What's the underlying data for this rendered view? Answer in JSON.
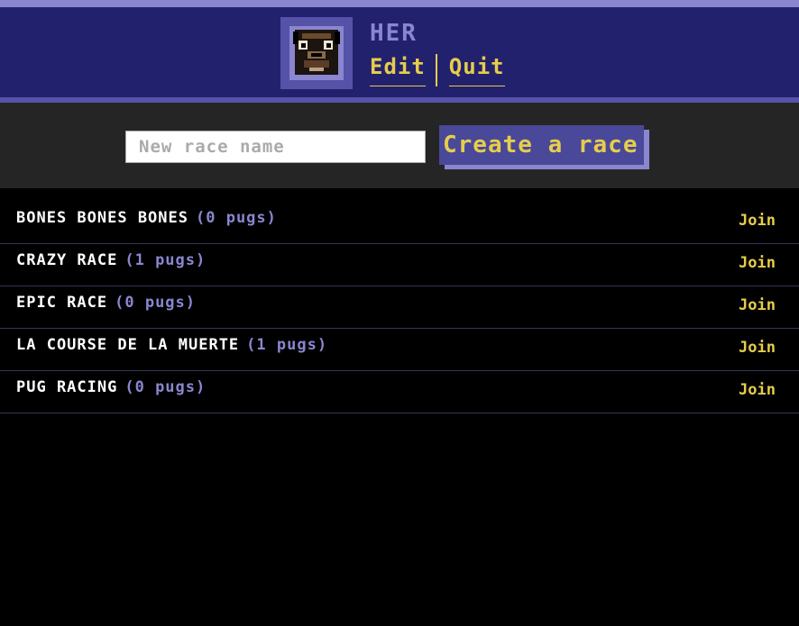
{
  "header": {
    "username": "HER",
    "edit_label": "Edit",
    "quit_label": "Quit",
    "avatar_icon": "pug-avatar-icon"
  },
  "create": {
    "placeholder": "New race name",
    "button_label": "Create a race"
  },
  "races": [
    {
      "name": "BONES BONES BONES",
      "count": "(0 pugs)",
      "join_label": "Join"
    },
    {
      "name": "CRAZY RACE",
      "count": "(1 pugs)",
      "join_label": "Join"
    },
    {
      "name": "EPIC RACE",
      "count": "(0 pugs)",
      "join_label": "Join"
    },
    {
      "name": "LA COURSE DE LA MUERTE",
      "count": "(1 pugs)",
      "join_label": "Join"
    },
    {
      "name": "PUG RACING",
      "count": "(0 pugs)",
      "join_label": "Join"
    }
  ],
  "colors": {
    "header_bg": "#22216e",
    "accent_purple": "#8a86cf",
    "accent_yellow": "#e6cd4b",
    "panel_bg": "#252525"
  }
}
